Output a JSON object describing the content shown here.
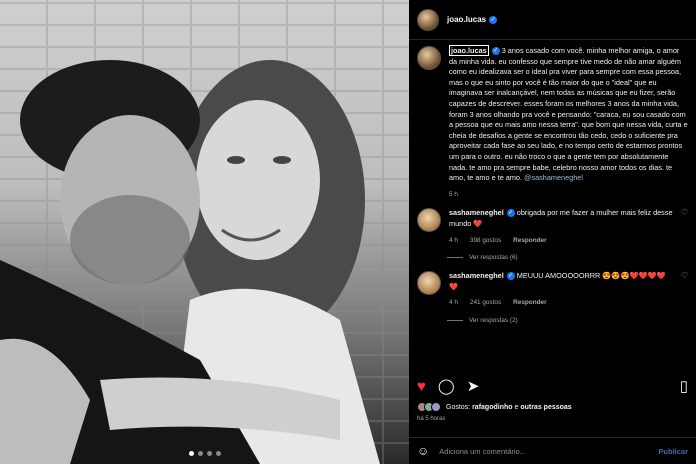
{
  "post": {
    "author": "joao.lucas",
    "caption": "3 anos casado com você. minha melhor amiga, o amor da minha vida. eu confesso que sempre tive medo de não amar alguém como eu idealizava ser o ideal pra viver para sempre com essa pessoa, mas o que eu sinto por você é tão maior do que o \"ideal\" que eu imaginava ser inalcançável, nem todas as músicas que eu fizer, serão capazes de descrever. esses foram os melhores 3 anos da minha vida, foram 3 anos olhando pra você e pensando: \"caraca, eu sou casado com a pessoa que eu mais amo nessa terra\". que bom que nessa vida, curta e cheia de desafios a gente se encontrou tão cedo, cedo o suficiente pra aproveitar cada fase ao seu lado, e no tempo certo de estarmos prontos um para o outro. eu não troco o que a gente tem por absolutamente nada. te amo pra sempre babe, celebro nosso amor todos os dias. te amo, te amo e te amo.",
    "caption_mention": "@sashameneghel",
    "caption_time": "5 h"
  },
  "comments": [
    {
      "user": "sashameneghel",
      "text": "obrigada por me fazer a mulher mais feliz desse mundo",
      "emoji": "❤️",
      "time": "4 h",
      "likes": "398 gostos",
      "reply": "Responder",
      "replies": "Ver respostas (6)"
    },
    {
      "user": "sashameneghel",
      "text": "MEUUU AMOOOOORRR",
      "emoji": "😍😍😍❤️❤️❤️❤️❤️",
      "time": "4 h",
      "likes": "241 gostos",
      "reply": "Responder",
      "replies": "Ver respostas (2)"
    }
  ],
  "actions": {
    "likes_prefix": "Gostos: ",
    "likes_user": "rafagodinho",
    "likes_and": " e ",
    "likes_others": "outras pessoas",
    "time_ago": "há 5 horas"
  },
  "add_comment": {
    "placeholder": "Adiciona um comentário...",
    "post_label": "Publicar"
  },
  "icons": {
    "heart": "♥",
    "comment": "◯",
    "share": "➤",
    "save": "▯",
    "small_heart": "♡",
    "emoji": "☺",
    "verified": "✓"
  },
  "colors": {
    "background": "#000000",
    "like_red": "#ff3040",
    "verified_blue": "#1877f2",
    "mention": "#9fb8d8",
    "publish": "#3d6fa8"
  }
}
